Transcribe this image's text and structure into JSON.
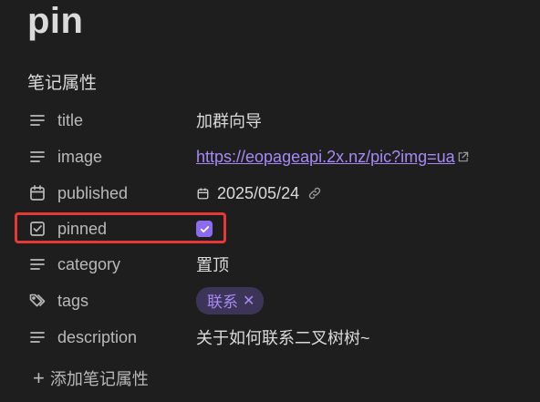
{
  "note": {
    "title": "pin",
    "properties_heading": "笔记属性",
    "properties": [
      {
        "key": "title",
        "icon": "text-lines-icon",
        "value": "加群向导"
      },
      {
        "key": "image",
        "icon": "text-lines-icon",
        "value": "https://eopageapi.2x.nz/pic?img=ua"
      },
      {
        "key": "published",
        "icon": "calendar-icon",
        "value": "2025/05/24"
      },
      {
        "key": "pinned",
        "icon": "checkbox-icon",
        "value": true
      },
      {
        "key": "category",
        "icon": "text-lines-icon",
        "value": "置顶"
      },
      {
        "key": "tags",
        "icon": "tags-icon",
        "value": [
          "联系"
        ]
      },
      {
        "key": "description",
        "icon": "text-lines-icon",
        "value": "关于如何联系二叉树树~"
      }
    ],
    "add_property_label": "添加笔记属性"
  },
  "colors": {
    "background": "#1e1e1e",
    "accent": "#8b6cf0",
    "link": "#a889f5",
    "highlight": "#e53935"
  }
}
